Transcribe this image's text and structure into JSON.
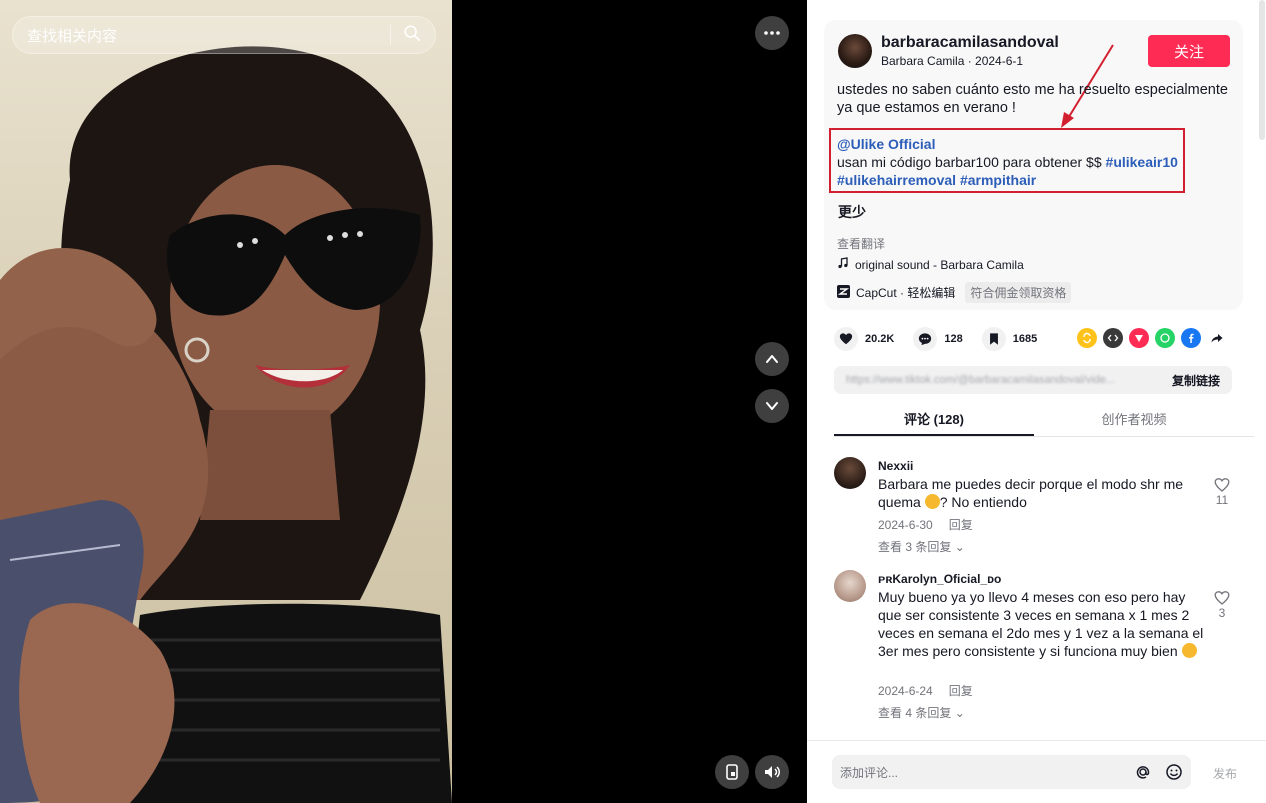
{
  "search": {
    "placeholder": "查找相关内容"
  },
  "post": {
    "author_handle": "barbaracamilasandoval",
    "author_name_date": "Barbara Camila · 2024-6-1",
    "follow_label": "关注",
    "caption": "ustedes no saben cuánto esto me ha resuelto especialmente ya que estamos en verano !",
    "mention": "@Ulike Official",
    "promo_text": "usan mi código barbar100 para obtener $$",
    "hashtags": [
      "#ulikeair10",
      "#ulikehairremoval",
      "#armpithair"
    ],
    "less_label": "更少",
    "translate_label": "查看翻译",
    "music": "original sound - Barbara Camila",
    "capcut": "CapCut · 轻松编辑",
    "capcut_badge": "符合佣金领取资格"
  },
  "stats": {
    "likes": "20.2K",
    "comments": "128",
    "saves": "1685"
  },
  "link_bar": {
    "url": "https://www.tiktok.com/@barbaracamilasandoval/vide...",
    "copy_label": "复制链接"
  },
  "tabs": [
    {
      "label": "评论 (128)"
    },
    {
      "label": "创作者视频"
    }
  ],
  "comments": [
    {
      "user": "Nexxii",
      "text": "Barbara me puedes decir porque el modo shr me quema",
      "text_end": "? No entiendo",
      "date": "2024-6-30",
      "reply_label": "回复",
      "view_replies": "查看 3 条回复",
      "likes": "11"
    },
    {
      "user": "ᴘʀKarolyn_Oficial_ᴅᴏ",
      "text": "Muy bueno ya yo llevo 4 meses con eso pero hay que ser consistente 3 veces en semana x 1 mes 2 veces en semana el 2do mes y 1 vez a la semana el 3er mes pero consistente y si funciona muy bien",
      "date": "2024-6-24",
      "reply_label": "回复",
      "view_replies": "查看 4 条回复",
      "likes": "3"
    }
  ],
  "comment_box": {
    "placeholder": "添加评论...",
    "post_label": "发布"
  },
  "colors": {
    "accent": "#fe2c55",
    "link": "#2b5db9",
    "annotation": "#d32030"
  }
}
